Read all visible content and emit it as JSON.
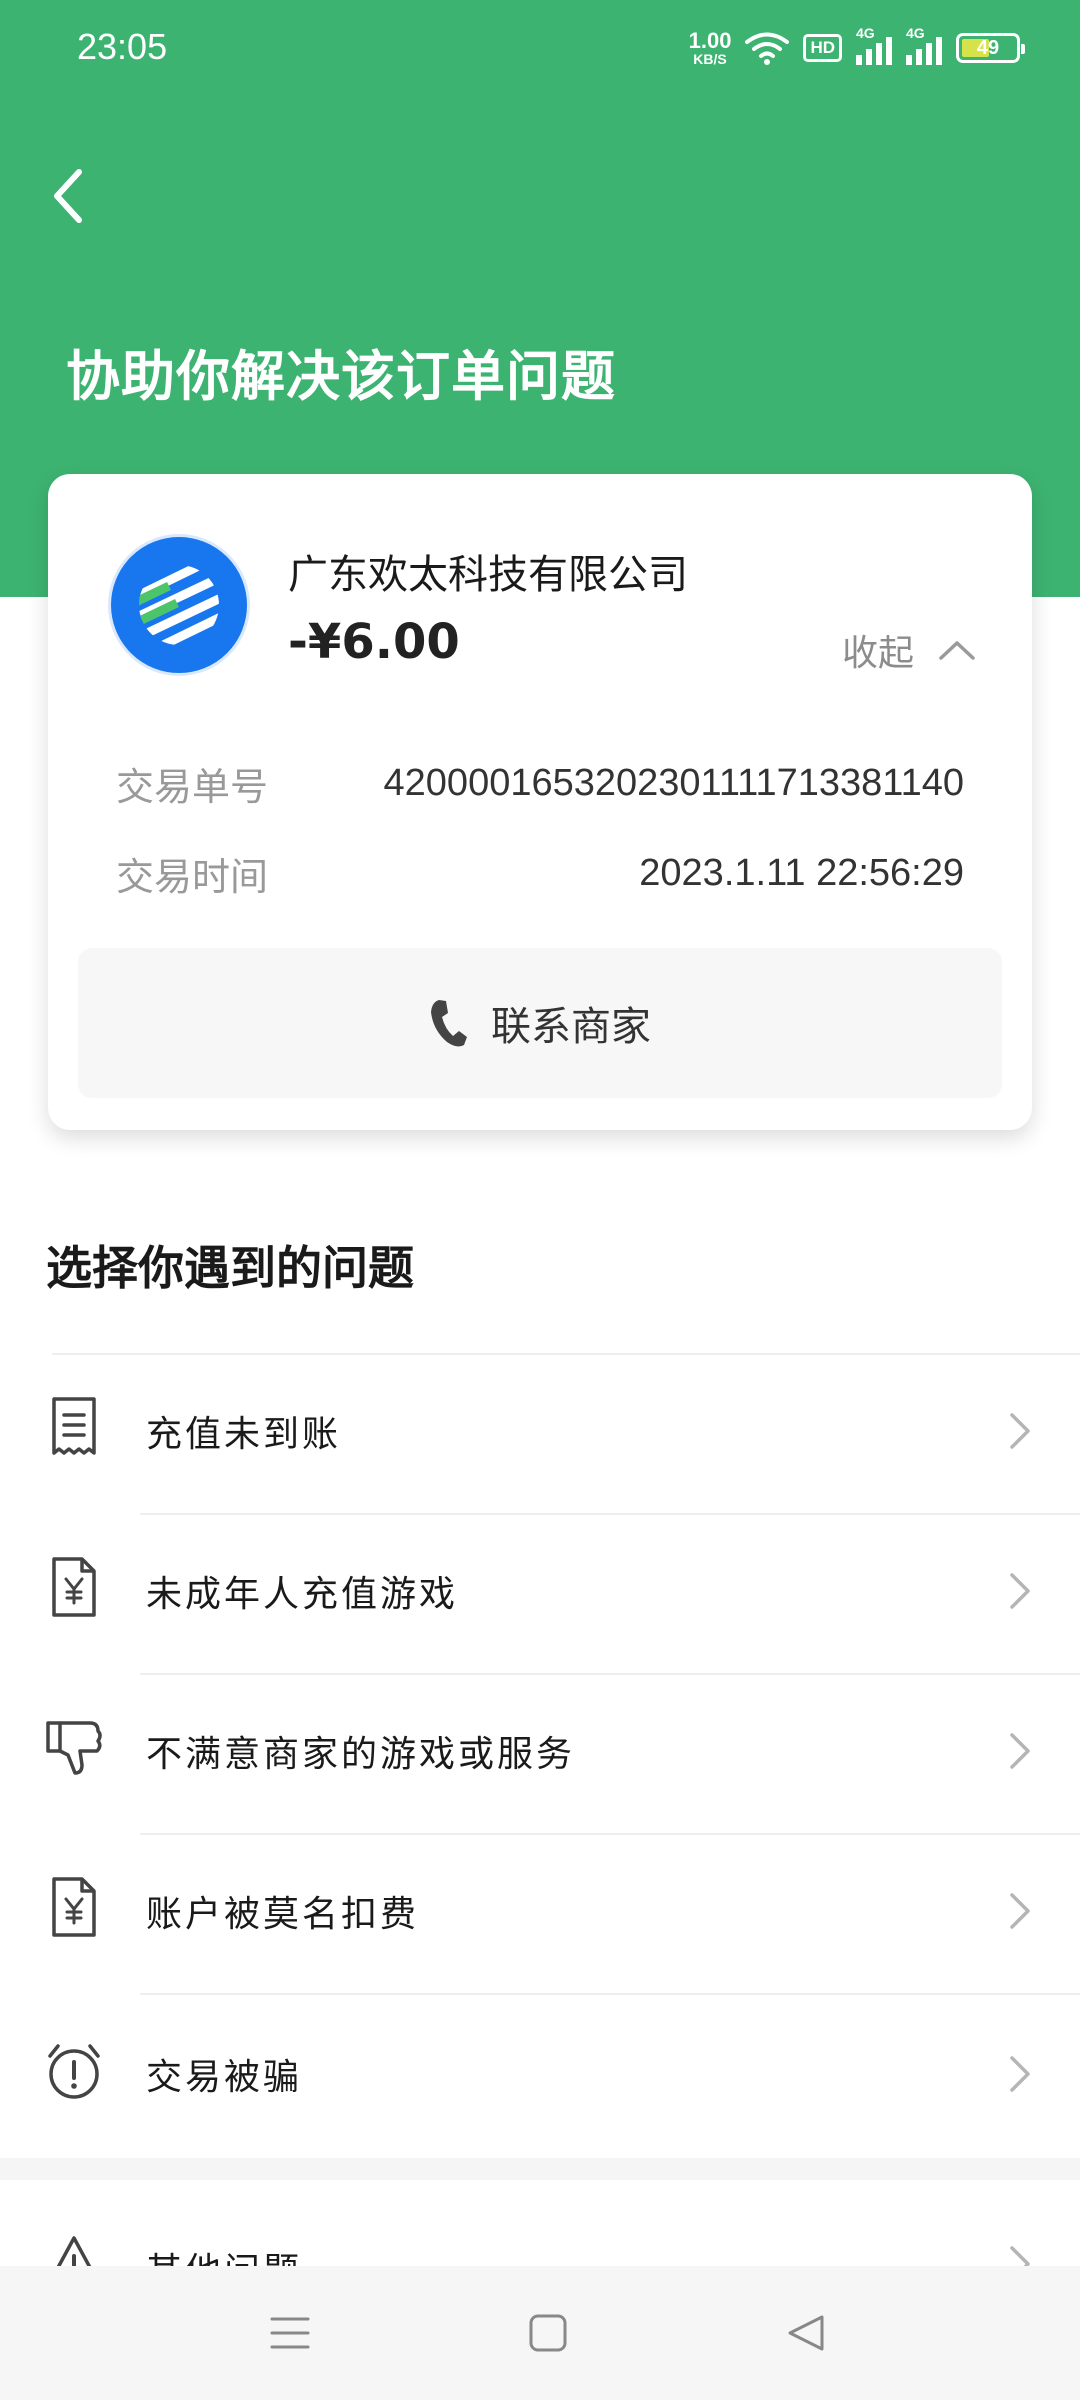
{
  "status_bar": {
    "time": "23:05",
    "net_speed_value": "1.00",
    "net_speed_unit": "KB/S",
    "hd_label": "HD",
    "sim1_label": "4G",
    "sim2_label": "4G",
    "battery_level": "49",
    "icons": [
      "wifi-icon",
      "hd-icon",
      "signal-icon",
      "signal-icon",
      "battery-icon"
    ]
  },
  "header": {
    "title": "协助你解决该订单问题",
    "back_icon": "chevron-left-icon",
    "background_color": "#3db371"
  },
  "order_card": {
    "merchant_name": "广东欢太科技有限公司",
    "amount": "-¥6.00",
    "collapse_label": "收起",
    "details": [
      {
        "label": "交易单号",
        "value": "4200001653202301111713381140"
      },
      {
        "label": "交易时间",
        "value": "2023.1.11 22:56:29"
      }
    ],
    "contact_label": "联系商家",
    "contact_icon": "phone-icon",
    "logo_color": "#1877ee"
  },
  "issues": {
    "section_title": "选择你遇到的问题",
    "items": [
      {
        "label": "充值未到账",
        "icon": "receipt-icon"
      },
      {
        "label": "未成年人充值游戏",
        "icon": "yuan-document-icon"
      },
      {
        "label": "不满意商家的游戏或服务",
        "icon": "thumbs-down-icon"
      },
      {
        "label": "账户被莫名扣费",
        "icon": "yuan-document-icon"
      },
      {
        "label": "交易被骗",
        "icon": "alarm-alert-icon"
      },
      {
        "label": "其他问题",
        "icon": "warning-icon"
      }
    ]
  },
  "nav_bar": {
    "buttons": [
      "menu-icon",
      "home-square-icon",
      "back-triangle-icon"
    ]
  }
}
